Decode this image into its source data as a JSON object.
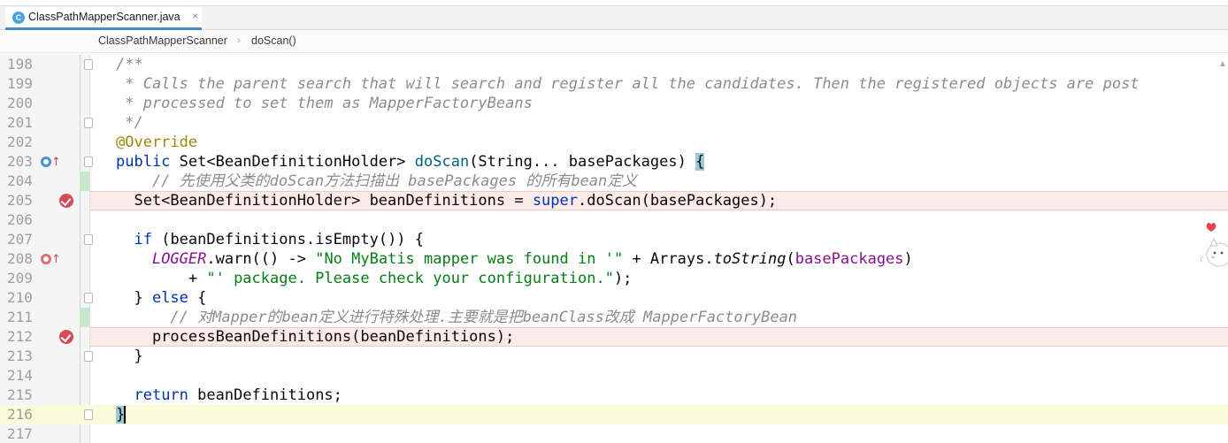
{
  "tab": {
    "label": "ClassPathMapperScanner.java",
    "icon": "class-file-icon",
    "close": "×"
  },
  "breadcrumb": {
    "class": "ClassPathMapperScanner",
    "separator": "›",
    "method": "doScan()"
  },
  "lines": [
    {
      "n": "198"
    },
    {
      "n": "199"
    },
    {
      "n": "200"
    },
    {
      "n": "201"
    },
    {
      "n": "202"
    },
    {
      "n": "203"
    },
    {
      "n": "204"
    },
    {
      "n": "205"
    },
    {
      "n": "206"
    },
    {
      "n": "207"
    },
    {
      "n": "208"
    },
    {
      "n": "209"
    },
    {
      "n": "210"
    },
    {
      "n": "211"
    },
    {
      "n": "212"
    },
    {
      "n": "213"
    },
    {
      "n": "214"
    },
    {
      "n": "215"
    },
    {
      "n": "216"
    },
    {
      "n": "217"
    }
  ],
  "code": {
    "l198": "/**",
    "l199": " * Calls the parent search that will search and register all the candidates. Then the registered objects are post",
    "l200": " * processed to set them as MapperFactoryBeans",
    "l201": " */",
    "l202": "@Override",
    "l203a": "public",
    "l203b": " Set<BeanDefinitionHolder> ",
    "l203c": "doScan",
    "l203d": "(String... basePackages) ",
    "l203e": "{",
    "l204": "    // 先使用父类的doScan方法扫描出 basePackages 的所有bean定义",
    "l205a": "  Set<BeanDefinitionHolder> beanDefinitions = ",
    "l205b": "super",
    "l205c": ".doScan(basePackages);",
    "l207a": "  ",
    "l207b": "if",
    "l207c": " (beanDefinitions.isEmpty()) {",
    "l208a": "    ",
    "l208b": "LOGGER",
    "l208c": ".warn(() -> ",
    "l208d": "\"No MyBatis mapper was found in '\"",
    "l208e": " + Arrays.",
    "l208f": "toString",
    "l208g": "(",
    "l208h": "basePackages",
    "l208i": ")",
    "l209a": "        + ",
    "l209b": "\"' package. Please check your configuration.\"",
    "l209c": ");",
    "l210a": "  } ",
    "l210b": "else",
    "l210c": " {",
    "l211": "      // 对Mapper的bean定义进行特殊处理.主要就是把beanClass改成 MapperFactoryBean",
    "l212": "    processBeanDefinitions(beanDefinitions);",
    "l213": "  }",
    "l215a": "  ",
    "l215b": "return",
    "l215c": " beanDefinitions;",
    "l216": "}"
  },
  "colors": {
    "keyword": "#0033b3",
    "string": "#067d17",
    "comment": "#8c8c8c",
    "annotation": "#9e880d",
    "method": "#00627a",
    "field": "#871094",
    "breakpoint": "#d64b57",
    "current_line": "#fbfbd9"
  },
  "icons": {
    "breakpoint": "breakpoint-icon",
    "override": "override-icon",
    "implements": "implemented-icon",
    "fold": "fold-icon",
    "warning": "warning-triangle-icon"
  }
}
